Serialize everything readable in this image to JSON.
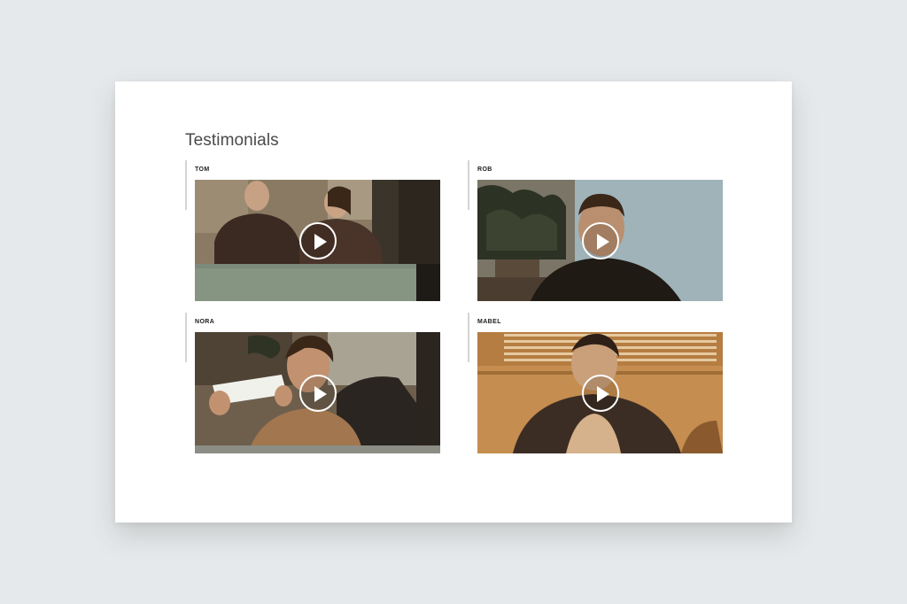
{
  "section": {
    "title": "Testimonials"
  },
  "testimonials": [
    {
      "name": "TOM"
    },
    {
      "name": "ROB"
    },
    {
      "name": "NORA"
    },
    {
      "name": "MABEL"
    }
  ],
  "colors": {
    "background": "#e6e9ec",
    "card": "#ffffff",
    "play_icon": "#ffffff"
  }
}
